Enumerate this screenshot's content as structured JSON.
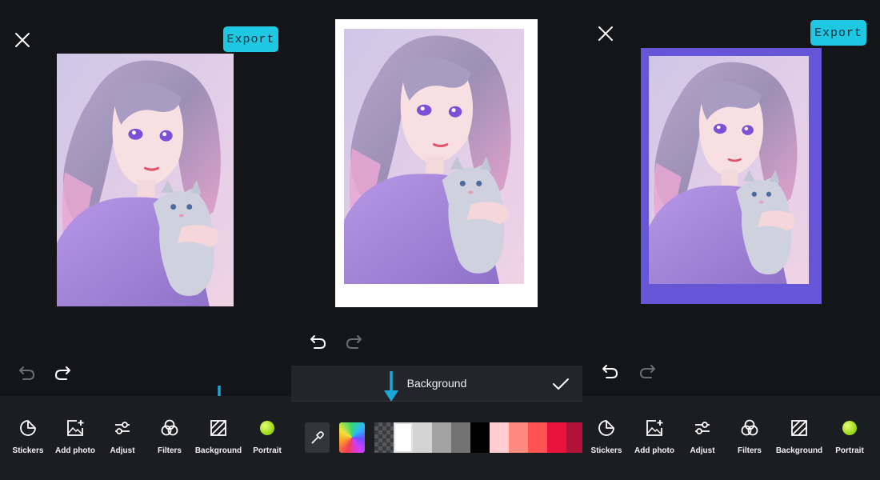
{
  "left_screen": {
    "export_label": "Export",
    "toolbar": [
      {
        "label": "Stickers",
        "icon": "stickers-icon"
      },
      {
        "label": "Add photo",
        "icon": "add-photo-icon"
      },
      {
        "label": "Adjust",
        "icon": "adjust-icon"
      },
      {
        "label": "Filters",
        "icon": "filters-icon"
      },
      {
        "label": "Background",
        "icon": "background-icon"
      },
      {
        "label": "Portrait",
        "icon": "portrait-icon"
      }
    ]
  },
  "middle_screen": {
    "panel_title": "Background",
    "swatches": [
      "#ffffff",
      "#d4d4d4",
      "#a3a3a3",
      "#737373",
      "#000000",
      "#ffcdd2",
      "#ff8a80",
      "#ff5252",
      "#e8123c",
      "#b0123a"
    ]
  },
  "right_screen": {
    "export_label": "Export",
    "toolbar": [
      {
        "label": "Stickers",
        "icon": "stickers-icon"
      },
      {
        "label": "Add photo",
        "icon": "add-photo-icon"
      },
      {
        "label": "Adjust",
        "icon": "adjust-icon"
      },
      {
        "label": "Filters",
        "icon": "filters-icon"
      },
      {
        "label": "Background",
        "icon": "background-icon"
      },
      {
        "label": "Portrait",
        "icon": "portrait-icon"
      }
    ]
  },
  "colors": {
    "export_button": "#1ec8e3",
    "arrow": "#1aa8d8",
    "portrait_dot": "#b6f21a",
    "frame_white": "#ffffff",
    "frame_purple": "#6655d6"
  }
}
